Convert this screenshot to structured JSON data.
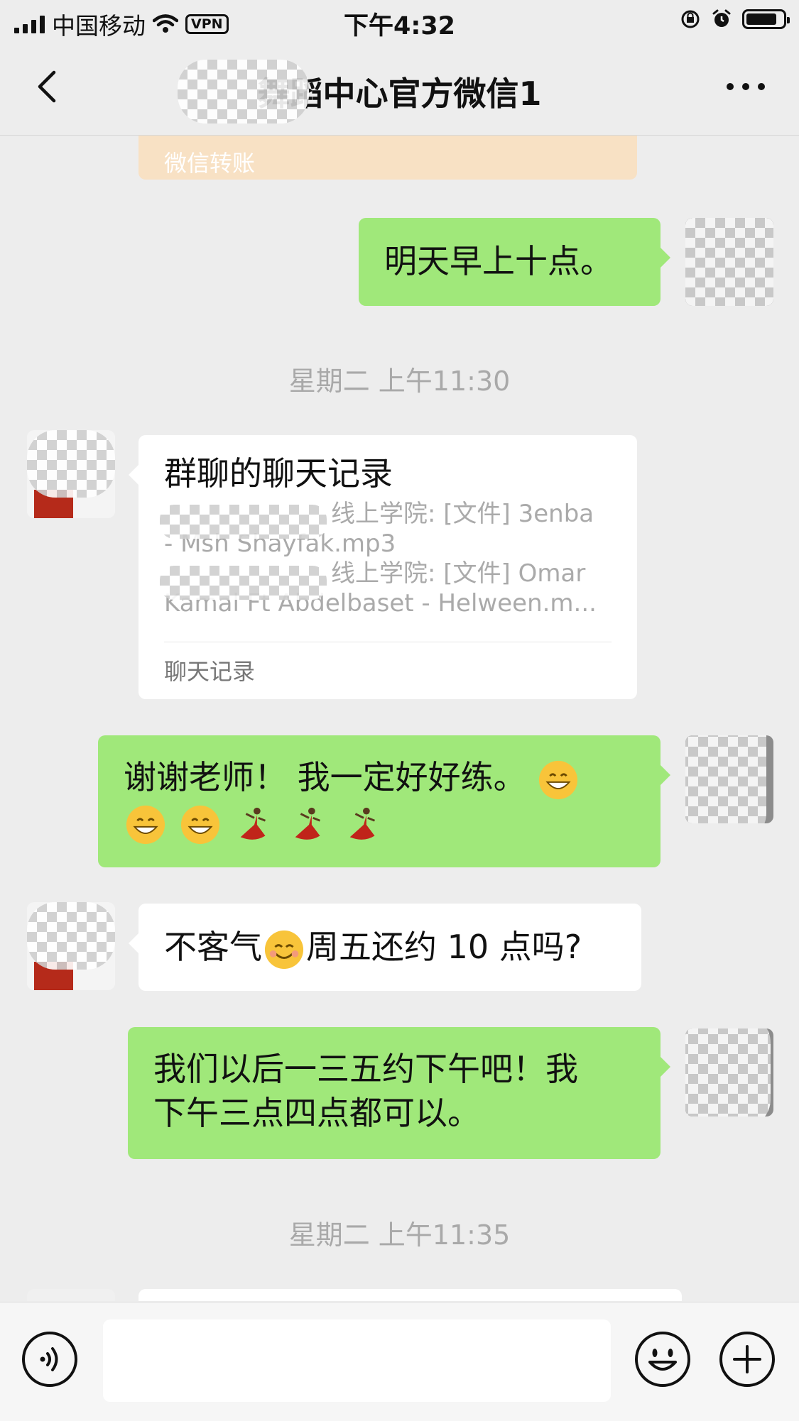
{
  "status_bar": {
    "carrier": "中国移动",
    "vpn": "VPN",
    "time": "下午4:32"
  },
  "header": {
    "title": "舞蹈中心官方微信1",
    "back_icon": "chevron-left-icon",
    "more_icon": "more-dots-icon"
  },
  "messages": {
    "transfer": {
      "label": "微信转账"
    },
    "msg1": {
      "text": "明天早上十点。"
    },
    "time1": {
      "text": "星期二 上午11:30"
    },
    "chat_record": {
      "title": "群聊的聊天记录",
      "line1": "线上学院: [文件] 3enba",
      "line2": "- Msh Shayfak.mp3",
      "line3": "线上学院: [文件] Omar",
      "line4": "Kamal Ft Abdelbaset - Helween.m...",
      "footer": "聊天记录"
    },
    "msg2": {
      "text": "谢谢老师！ 我一定好好练。"
    },
    "msg3": {
      "text_before": "不客气",
      "text_after": "周五还约 10 点吗?"
    },
    "msg4": {
      "line1": "我们以后一三五约下午吧！我",
      "line2": "下午三点四点都可以。"
    },
    "time2": {
      "text": "星期二 上午11:35"
    }
  },
  "colors": {
    "background": "#ededed",
    "my_bubble": "#a0e87a",
    "their_bubble": "#ffffff",
    "transfer_card": "#f8e1c4"
  }
}
